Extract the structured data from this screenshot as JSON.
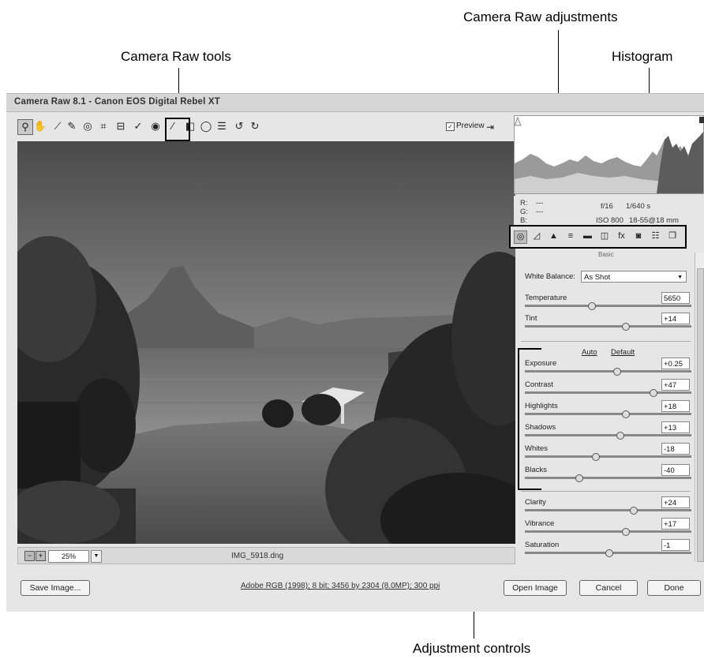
{
  "callouts": {
    "camera_raw_adjustments": "Camera Raw adjustments",
    "camera_raw_tools": "Camera Raw tools",
    "histogram": "Histogram",
    "adjustment_controls": "Adjustment controls"
  },
  "window": {
    "title": "Camera Raw 8.1  -  Canon EOS Digital Rebel XT"
  },
  "toolbar": {
    "tools": [
      {
        "icon": "zoom-icon",
        "glyph": "⚲"
      },
      {
        "icon": "hand-icon",
        "glyph": "✋"
      },
      {
        "icon": "white-balance-icon",
        "glyph": "⟋"
      },
      {
        "icon": "color-sampler-icon",
        "glyph": "✎"
      },
      {
        "icon": "target-adjustment-icon",
        "glyph": "◎"
      },
      {
        "icon": "crop-icon",
        "glyph": "⌗"
      },
      {
        "icon": "straighten-icon",
        "glyph": "⊟"
      },
      {
        "icon": "spot-removal-icon",
        "glyph": "✓"
      },
      {
        "icon": "red-eye-icon",
        "glyph": "◉"
      },
      {
        "icon": "adjustment-brush-icon",
        "glyph": "⁄"
      },
      {
        "icon": "graduated-filter-icon",
        "glyph": "◧"
      },
      {
        "icon": "radial-filter-icon",
        "glyph": "◯"
      },
      {
        "icon": "preferences-icon",
        "glyph": "☰"
      },
      {
        "icon": "rotate-ccw-icon",
        "glyph": "↺"
      },
      {
        "icon": "rotate-cw-icon",
        "glyph": "↻"
      }
    ],
    "preview_label": "Preview",
    "preview_checked": true
  },
  "status": {
    "zoom": "25%",
    "filename": "IMG_5918.dng"
  },
  "bottom": {
    "save_image": "Save Image...",
    "info": "Adobe RGB (1998); 8 bit; 3456 by 2304 (8.0MP); 300 ppi",
    "open_image": "Open Image",
    "cancel": "Cancel",
    "done": "Done"
  },
  "readout": {
    "r": "R:",
    "g": "G:",
    "b": "B:",
    "dash": "---",
    "aperture": "f/16",
    "shutter": "1/640 s",
    "iso": "ISO 800",
    "lens": "18-55@18 mm"
  },
  "panel": {
    "name": "Basic",
    "white_balance_label": "White Balance:",
    "white_balance_value": "As Shot",
    "auto": "Auto",
    "default": "Default",
    "sliders": [
      {
        "label": "Temperature",
        "value": "5650",
        "pos": 0.4
      },
      {
        "label": "Tint",
        "value": "+14",
        "pos": 0.6
      },
      {
        "label": "Exposure",
        "value": "+0.25",
        "pos": 0.55
      },
      {
        "label": "Contrast",
        "value": "+47",
        "pos": 0.77
      },
      {
        "label": "Highlights",
        "value": "+18",
        "pos": 0.6
      },
      {
        "label": "Shadows",
        "value": "+13",
        "pos": 0.57
      },
      {
        "label": "Whites",
        "value": "-18",
        "pos": 0.42
      },
      {
        "label": "Blacks",
        "value": "-40",
        "pos": 0.32
      },
      {
        "label": "Clarity",
        "value": "+24",
        "pos": 0.65
      },
      {
        "label": "Vibrance",
        "value": "+17",
        "pos": 0.6
      },
      {
        "label": "Saturation",
        "value": "-1",
        "pos": 0.5
      }
    ]
  },
  "tabs": [
    {
      "icon": "basic-tab-icon",
      "glyph": "◎"
    },
    {
      "icon": "tone-curve-tab-icon",
      "glyph": "◿"
    },
    {
      "icon": "detail-tab-icon",
      "glyph": "▲"
    },
    {
      "icon": "hsl-tab-icon",
      "glyph": "≡"
    },
    {
      "icon": "split-toning-tab-icon",
      "glyph": "▬"
    },
    {
      "icon": "lens-corrections-tab-icon",
      "glyph": "◫"
    },
    {
      "icon": "effects-tab-icon",
      "glyph": "fx"
    },
    {
      "icon": "camera-calibration-tab-icon",
      "glyph": "◙"
    },
    {
      "icon": "presets-tab-icon",
      "glyph": "☷"
    },
    {
      "icon": "snapshots-tab-icon",
      "glyph": "❐"
    }
  ]
}
